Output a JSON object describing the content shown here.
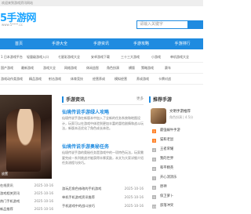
{
  "topbar": {
    "text": "欢迎来到游戏资讯网站"
  },
  "logo": {
    "text": "5手游网",
    "url": "www.5****.cc"
  },
  "search": {
    "placeholder": "请输入关键字"
  },
  "nav": {
    "items": [
      "首页",
      "手游大全",
      "手游资讯",
      "手游攻略",
      "手游排行"
    ]
  },
  "subnav": {
    "row1": [
      "1 日本游戏平台",
      "轻量级游戏入口",
      "七星彩游戏大全",
      "安卓游戏下载",
      "三十三大游戏",
      "小游戏",
      "单机游戏大全"
    ],
    "row2": [
      "国产游戏",
      "最新游戏",
      "游戏大全",
      "网络游戏",
      "休闲益智",
      "角色扮演",
      "横版",
      "策略游戏",
      "赛车"
    ],
    "row3": [
      "游戏动作类游戏",
      "精品游戏",
      "射击游戏",
      "体育竞技",
      "经营养成",
      "模拟经营",
      "养成游戏",
      "卡牌对战"
    ]
  },
  "hero": {
    "caption": "放置"
  },
  "left_list": [
    {
      "title": "在线资讯",
      "date": "2025-10-16"
    },
    {
      "title": "游戏相关资讯",
      "date": "2025-10-16"
    },
    {
      "title": "热门手机游戏",
      "date": "2025-10-16"
    },
    {
      "title": "新品推荐",
      "date": "2025-10-16"
    }
  ],
  "center": {
    "title": "手游资讯",
    "more": "更多",
    "articles": [
      {
        "headline": "仙境传说手游绿人攻略",
        "body": "仙境传说手游在新版本中加入了全新的任务系统和地图设计，玩家可以在游戏中体验到更加丰富的冒险剧情和战斗玩法，新版本还优化了角色成长体验。"
      },
      {
        "headline": "仙境传说手游奥秘任务",
        "body": "仙境传说手游的奥秘任务是游戏中的一项特色玩法，玩家需要完成一系列挑战才能获得丰厚奖励，本文为大家详细介绍任务流程与技巧。"
      }
    ],
    "list": [
      {
        "title": "游玩后角色修改的手机游戏",
        "date": "2025-10-16"
      },
      {
        "title": "单机手机游戏资讯推荐",
        "date": "2025-10-16"
      },
      {
        "title": "手机游戏中的战斗技巧",
        "date": "2025-10-16"
      }
    ]
  },
  "right": {
    "title": "推荐手游",
    "top": {
      "name": "文明手游推荐",
      "meta": "角色扮演 | 4.5分"
    },
    "items": [
      {
        "num": "2",
        "label": "最强蜗牛手游"
      },
      {
        "num": "3",
        "label": "猫和老鼠"
      },
      {
        "num": "4",
        "label": "王者荣耀"
      },
      {
        "num": "5",
        "label": "我的世界"
      },
      {
        "num": "6",
        "label": "和平精英"
      },
      {
        "num": "7",
        "label": "开心消消乐"
      },
      {
        "num": "8",
        "label": "原神"
      },
      {
        "num": "9",
        "label": "保卫萝卜"
      },
      {
        "num": "10",
        "label": "部落冲突"
      }
    ]
  },
  "colors": {
    "brand": "#1f8be0",
    "logo": "#1aa4ff",
    "rank_hot": "#ff7f24"
  }
}
